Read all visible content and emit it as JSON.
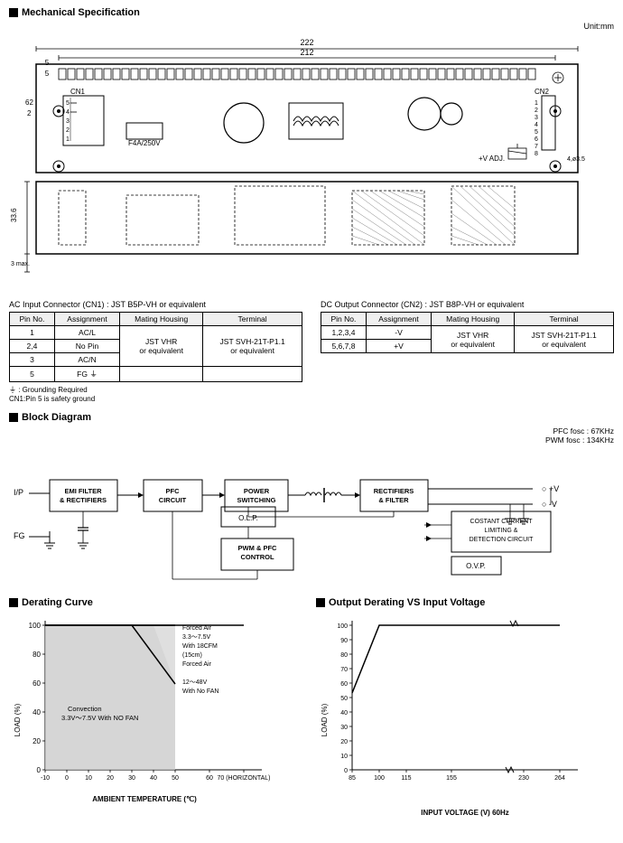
{
  "mechanical": {
    "title": "Mechanical Specification",
    "unit": "Unit:mm",
    "dims": {
      "d222": "222",
      "d212": "212",
      "d5": "5",
      "d5b": "5",
      "d62": "62",
      "d2": "2",
      "d33_6": "33.6",
      "d3max": "3 max.",
      "d4": "4",
      "dphi35": "4,ø3.5"
    },
    "labels": {
      "cn1": "CN1",
      "cn2": "CN2",
      "fuse": "F4A/250V",
      "vadj": "+V ADJ."
    }
  },
  "connectors": {
    "ac": {
      "title": "AC Input Connector (CN1) : JST B5P-VH or equivalent",
      "headers": [
        "Pin No.",
        "Assignment",
        "Mating Housing",
        "Terminal"
      ],
      "rows": [
        [
          "1",
          "AC/L",
          "",
          ""
        ],
        [
          "2,4",
          "No Pin",
          "JST VHR",
          "JST SVH-21T-P1.1"
        ],
        [
          "3",
          "AC/N",
          "or equivalent",
          "or equivalent"
        ],
        [
          "5",
          "FG ⏚",
          "",
          ""
        ]
      ],
      "note1": "⏚ : Grounding Required",
      "note2": "CN1:Pin 5 is safety ground"
    },
    "dc": {
      "title": "DC Output Connector (CN2) : JST B8P-VH or equivalent",
      "headers": [
        "Pin No.",
        "Assignment",
        "Mating Housing",
        "Terminal"
      ],
      "rows": [
        [
          "1,2,3,4",
          "-V",
          "JST VHR",
          "JST SVH-21T-P1.1"
        ],
        [
          "5,6,7,8",
          "+V",
          "or equivalent",
          "or equivalent"
        ]
      ]
    }
  },
  "blockDiagram": {
    "title": "Block Diagram",
    "fosc1": "PFC fosc : 67KHz",
    "fosc2": "PWM fosc : 134KHz",
    "blocks": [
      "EMI FILTER & RECTIFIERS",
      "PFC CIRCUIT",
      "POWER SWITCHING",
      "RECTIFIERS & FILTER",
      "COSTANT CURRENT LIMITING & DETECTION CIRCUIT",
      "PWM & PFC CONTROL",
      "O.L.P.",
      "O.V.P."
    ],
    "labels": {
      "ip": "I/P",
      "fg": "FG",
      "plusV": "+V",
      "minusV": "-V"
    }
  },
  "deratingCurve": {
    "title": "Derating Curve",
    "yLabel": "LOAD (%)",
    "xLabel": "AMBIENT TEMPERATURE (℃)",
    "xAxis": [
      "-10",
      "0",
      "10",
      "20",
      "30",
      "40",
      "50",
      "60",
      "70 (HORIZONTAL)"
    ],
    "yAxis": [
      "0",
      "20",
      "40",
      "60",
      "80",
      "100"
    ],
    "annotations": [
      "Forced Air",
      "3.3～7.5V With 18CFM (15cm) Forced Air",
      "Convection 3.3V～7.5V With NO FAN",
      "12～48V With No FAN"
    ]
  },
  "outputDerating": {
    "title": "Output Derating VS Input Voltage",
    "yLabel": "LOAD (%)",
    "xLabel": "INPUT VOLTAGE (V) 60Hz",
    "xAxis": [
      "85",
      "100",
      "115",
      "155",
      "230",
      "264"
    ],
    "yAxis": [
      "0",
      "10",
      "20",
      "30",
      "40",
      "50",
      "60",
      "70",
      "80",
      "90",
      "100"
    ]
  }
}
